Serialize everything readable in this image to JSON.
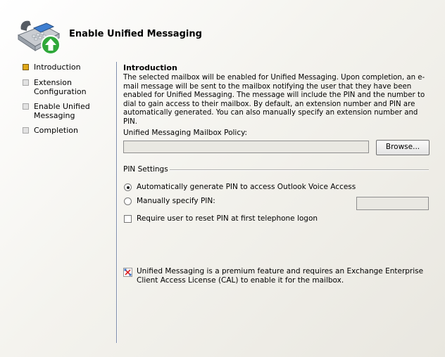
{
  "header": {
    "title": "Enable Unified Messaging",
    "icon": "telephone-with-green-arrow-icon"
  },
  "steps": [
    {
      "label": "Introduction",
      "active": true
    },
    {
      "label": "Extension Configuration",
      "active": false
    },
    {
      "label": "Enable Unified Messaging",
      "active": false
    },
    {
      "label": "Completion",
      "active": false
    }
  ],
  "main": {
    "section_title": "Introduction",
    "intro_text": "The selected mailbox will be enabled for Unified Messaging. Upon completion, an e-mail message will be sent to the mailbox notifying the user that they have been enabled for Unified Messaging. The message will include the PIN and the number to dial to gain access to their mailbox. By default, an extension number and PIN are automatically generated. You can also manually specify an extension number and PIN.",
    "policy_label": "Unified Messaging Mailbox Policy:",
    "policy_value": "",
    "browse_label": "Browse...",
    "pin_settings_label": "PIN Settings",
    "auto_pin_label": "Automatically generate PIN to access Outlook Voice Access",
    "manual_pin_label": "Manually specify PIN:",
    "manual_pin_value": "",
    "reset_pin_label": "Require user to reset PIN at first telephone logon",
    "note_text": "Unified Messaging is a premium feature and requires an Exchange Enterprise Client Access License (CAL) to enable it for the mailbox."
  },
  "colors": {
    "active_step": "#e0a818",
    "divider": "#7e8caa"
  }
}
